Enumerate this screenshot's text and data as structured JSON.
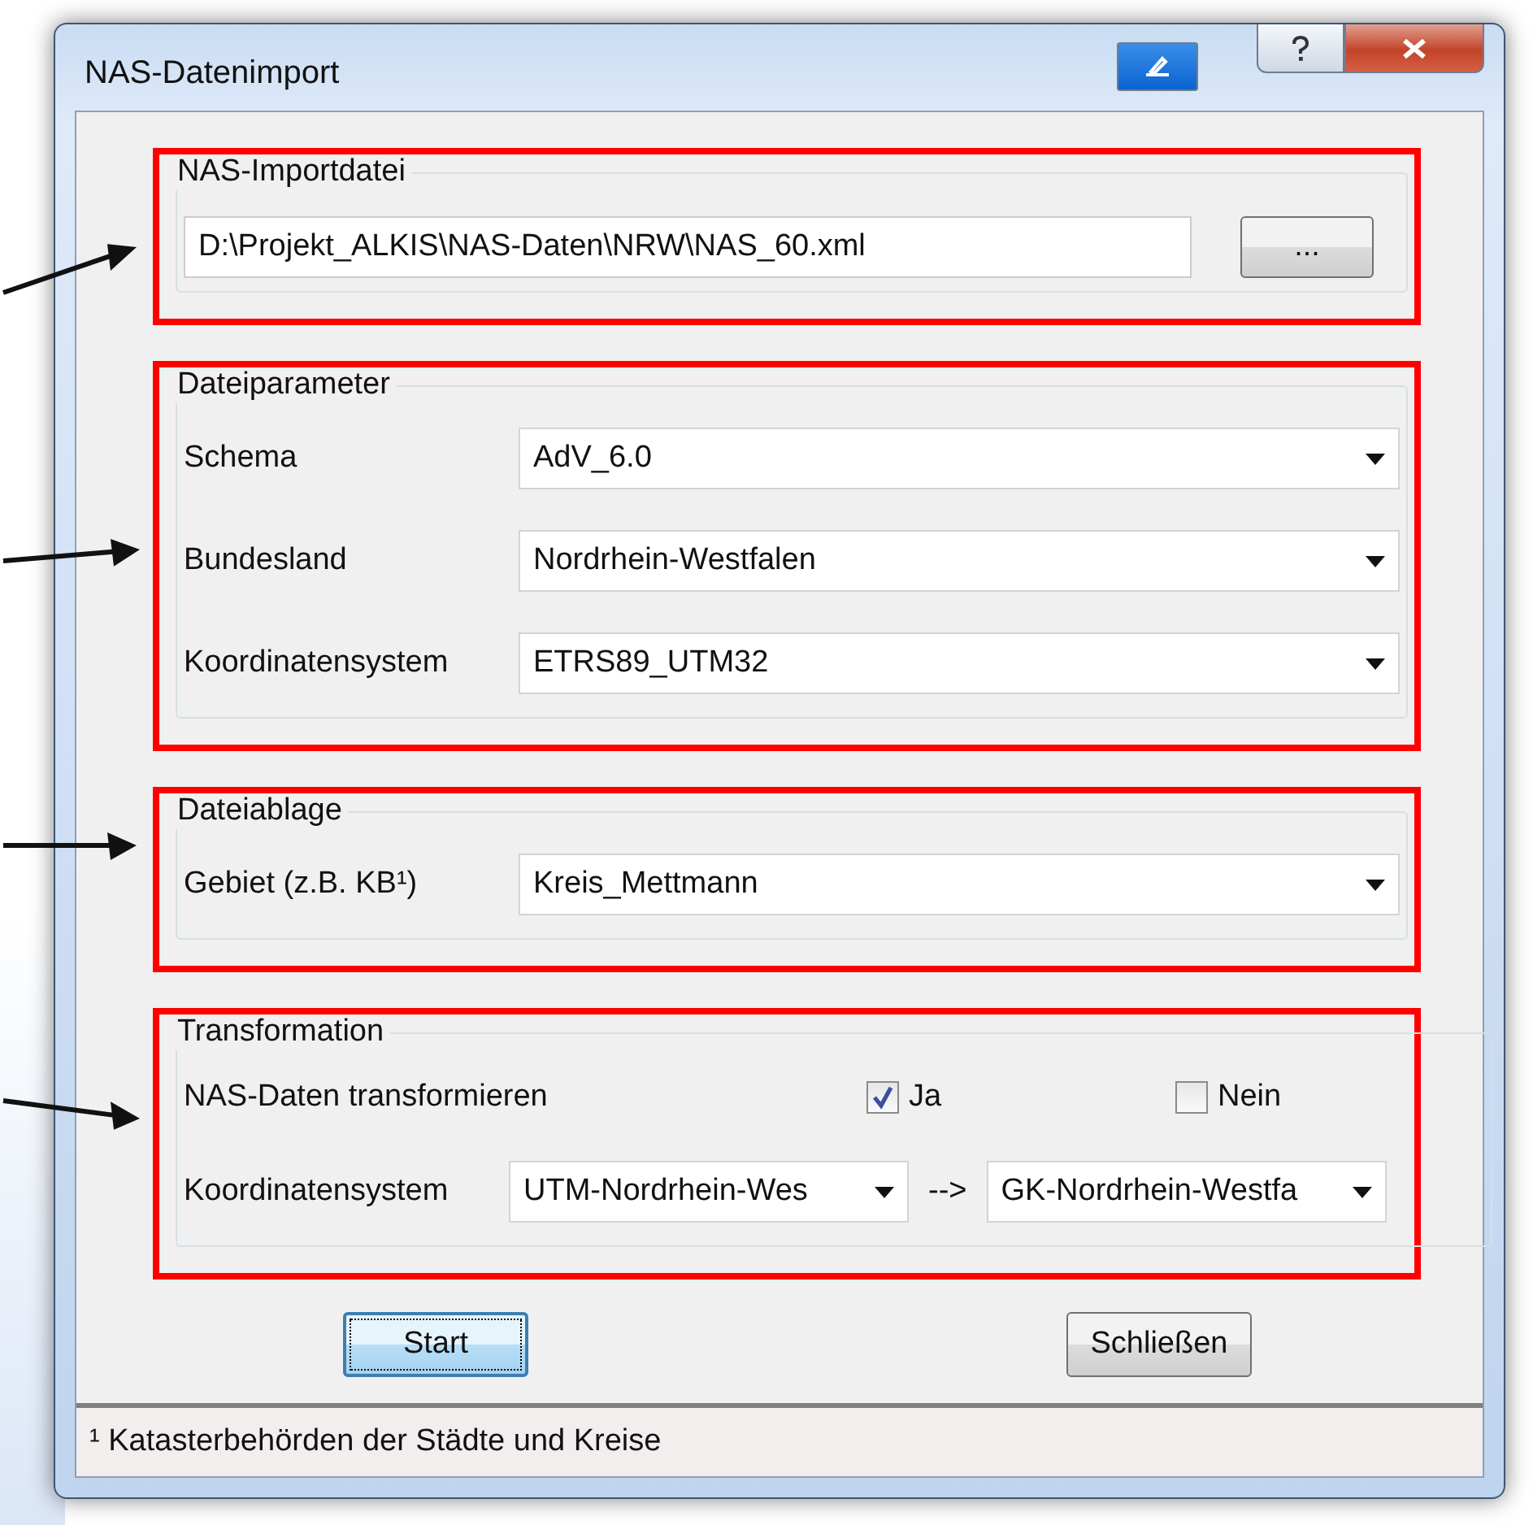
{
  "window": {
    "title": "NAS-Datenimport"
  },
  "import_file": {
    "legend": "NAS-Importdatei",
    "path": "D:\\Projekt_ALKIS\\NAS-Daten\\NRW\\NAS_60.xml",
    "browse_button": "..."
  },
  "file_parameters": {
    "legend": "Dateiparameter",
    "fields": [
      {
        "label": "Schema",
        "value": "AdV_6.0"
      },
      {
        "label": "Bundesland",
        "value": "Nordrhein-Westfalen"
      },
      {
        "label": "Koordinatensystem",
        "value": "ETRS89_UTM32"
      }
    ]
  },
  "file_storage": {
    "legend": "Dateiablage",
    "fields": [
      {
        "label": "Gebiet  (z.B. KB¹)",
        "value": "Kreis_Mettmann"
      }
    ]
  },
  "transformation": {
    "legend": "Transformation",
    "question": "NAS-Daten transformieren",
    "options": [
      {
        "label": "Ja",
        "checked": true
      },
      {
        "label": "Nein",
        "checked": false
      }
    ],
    "crs_label": "Koordinatensystem",
    "from": "UTM-Nordrhein-Wes",
    "arrow": "-->",
    "to": "GK-Nordrhein-Westfa"
  },
  "buttons": [
    {
      "label": "Start",
      "focused": true
    },
    {
      "label": "Schließen",
      "focused": false
    }
  ],
  "status_bar": "¹ Katasterbehörden der Städte und Kreise"
}
